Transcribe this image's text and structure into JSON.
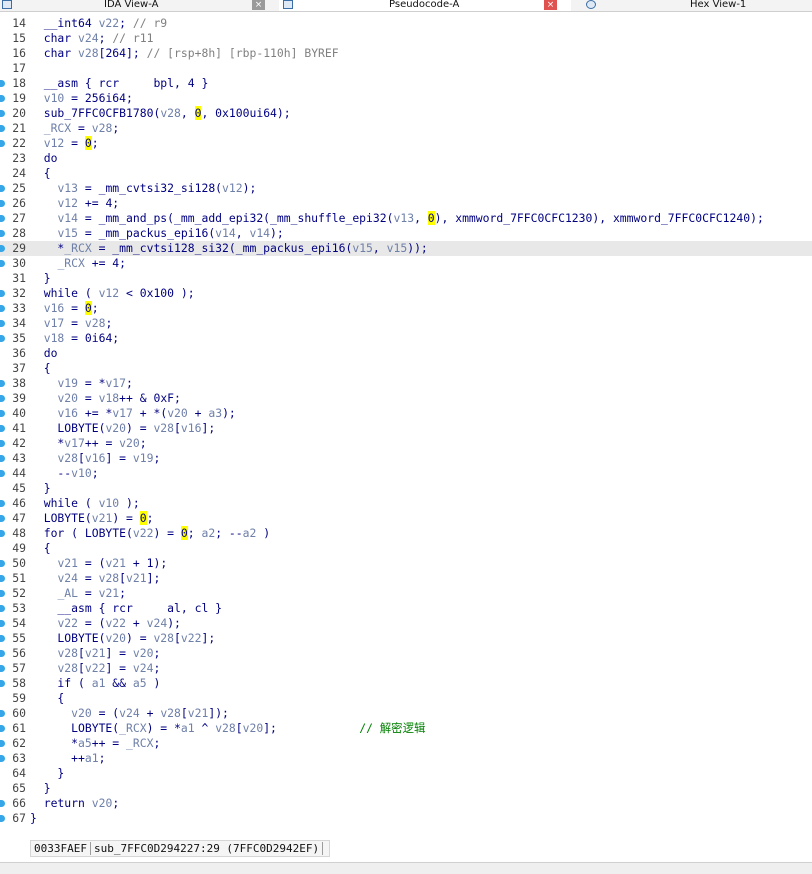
{
  "tabs": [
    {
      "label": "IDA View-A",
      "close": "×",
      "active": false
    },
    {
      "label": "Pseudocode-A",
      "close": "×",
      "active": true
    },
    {
      "label": "Hex View-1",
      "close": "",
      "active": false
    }
  ],
  "code_lines": [
    {
      "n": "14",
      "dot": false,
      "t": [
        [
          "p",
          "  __int64 "
        ],
        [
          "v",
          "v22"
        ],
        [
          "p",
          "; "
        ],
        [
          "c",
          "// r9"
        ]
      ]
    },
    {
      "n": "15",
      "dot": false,
      "t": [
        [
          "p",
          "  char "
        ],
        [
          "v",
          "v24"
        ],
        [
          "p",
          "; "
        ],
        [
          "c",
          "// r11"
        ]
      ]
    },
    {
      "n": "16",
      "dot": false,
      "t": [
        [
          "p",
          "  char "
        ],
        [
          "v",
          "v28"
        ],
        [
          "p",
          "[264]; "
        ],
        [
          "c",
          "// [rsp+8h] [rbp-110h] BYREF"
        ]
      ]
    },
    {
      "n": "17",
      "dot": false,
      "t": []
    },
    {
      "n": "18",
      "dot": true,
      "t": [
        [
          "p",
          "  __asm { rcr     bpl, 4 }"
        ]
      ]
    },
    {
      "n": "19",
      "dot": true,
      "t": [
        [
          "p",
          "  "
        ],
        [
          "v",
          "v10"
        ],
        [
          "p",
          " = 256i64;"
        ]
      ]
    },
    {
      "n": "20",
      "dot": true,
      "t": [
        [
          "p",
          "  sub_7FFC0CFB1780("
        ],
        [
          "v",
          "v28"
        ],
        [
          "p",
          ", "
        ],
        [
          "h",
          "0"
        ],
        [
          "p",
          ", 0x100ui64);"
        ]
      ]
    },
    {
      "n": "21",
      "dot": true,
      "t": [
        [
          "p",
          "  "
        ],
        [
          "v",
          "_RCX"
        ],
        [
          "p",
          " = "
        ],
        [
          "v",
          "v28"
        ],
        [
          "p",
          ";"
        ]
      ]
    },
    {
      "n": "22",
      "dot": true,
      "t": [
        [
          "p",
          "  "
        ],
        [
          "v",
          "v12"
        ],
        [
          "p",
          " = "
        ],
        [
          "h",
          "0"
        ],
        [
          "p",
          ";"
        ]
      ]
    },
    {
      "n": "23",
      "dot": false,
      "t": [
        [
          "p",
          "  do"
        ]
      ]
    },
    {
      "n": "24",
      "dot": false,
      "t": [
        [
          "p",
          "  {"
        ]
      ]
    },
    {
      "n": "25",
      "dot": true,
      "t": [
        [
          "p",
          "    "
        ],
        [
          "v",
          "v13"
        ],
        [
          "p",
          " = _mm_cvtsi32_si128("
        ],
        [
          "v",
          "v12"
        ],
        [
          "p",
          ");"
        ]
      ]
    },
    {
      "n": "26",
      "dot": true,
      "t": [
        [
          "p",
          "    "
        ],
        [
          "v",
          "v12"
        ],
        [
          "p",
          " += 4;"
        ]
      ]
    },
    {
      "n": "27",
      "dot": true,
      "t": [
        [
          "p",
          "    "
        ],
        [
          "v",
          "v14"
        ],
        [
          "p",
          " = _mm_and_ps(_mm_add_epi32(_mm_shuffle_epi32("
        ],
        [
          "v",
          "v13"
        ],
        [
          "p",
          ", "
        ],
        [
          "h",
          "0"
        ],
        [
          "p",
          "), xmmword_7FFC0CFC1230), xmmword_7FFC0CFC1240);"
        ]
      ]
    },
    {
      "n": "28",
      "dot": true,
      "t": [
        [
          "p",
          "    "
        ],
        [
          "v",
          "v15"
        ],
        [
          "p",
          " = _mm_packus_epi16("
        ],
        [
          "v",
          "v14"
        ],
        [
          "p",
          ", "
        ],
        [
          "v",
          "v14"
        ],
        [
          "p",
          ");"
        ]
      ]
    },
    {
      "n": "29",
      "dot": true,
      "cur": true,
      "t": [
        [
          "p",
          "    *"
        ],
        [
          "v",
          "_RCX"
        ],
        [
          "p",
          " = _mm_cvtsi128_si32(_mm_packus_epi16("
        ],
        [
          "v",
          "v15"
        ],
        [
          "p",
          ", "
        ],
        [
          "v",
          "v15"
        ],
        [
          "p",
          "));"
        ]
      ]
    },
    {
      "n": "30",
      "dot": true,
      "t": [
        [
          "p",
          "    "
        ],
        [
          "v",
          "_RCX"
        ],
        [
          "p",
          " += 4;"
        ]
      ]
    },
    {
      "n": "31",
      "dot": false,
      "t": [
        [
          "p",
          "  }"
        ]
      ]
    },
    {
      "n": "32",
      "dot": true,
      "t": [
        [
          "p",
          "  while ( "
        ],
        [
          "v",
          "v12"
        ],
        [
          "p",
          " < 0x100 );"
        ]
      ]
    },
    {
      "n": "33",
      "dot": true,
      "t": [
        [
          "p",
          "  "
        ],
        [
          "v",
          "v16"
        ],
        [
          "p",
          " = "
        ],
        [
          "h",
          "0"
        ],
        [
          "p",
          ";"
        ]
      ]
    },
    {
      "n": "34",
      "dot": true,
      "t": [
        [
          "p",
          "  "
        ],
        [
          "v",
          "v17"
        ],
        [
          "p",
          " = "
        ],
        [
          "v",
          "v28"
        ],
        [
          "p",
          ";"
        ]
      ]
    },
    {
      "n": "35",
      "dot": true,
      "t": [
        [
          "p",
          "  "
        ],
        [
          "v",
          "v18"
        ],
        [
          "p",
          " = 0i64;"
        ]
      ]
    },
    {
      "n": "36",
      "dot": false,
      "t": [
        [
          "p",
          "  do"
        ]
      ]
    },
    {
      "n": "37",
      "dot": false,
      "t": [
        [
          "p",
          "  {"
        ]
      ]
    },
    {
      "n": "38",
      "dot": true,
      "t": [
        [
          "p",
          "    "
        ],
        [
          "v",
          "v19"
        ],
        [
          "p",
          " = *"
        ],
        [
          "v",
          "v17"
        ],
        [
          "p",
          ";"
        ]
      ]
    },
    {
      "n": "39",
      "dot": true,
      "t": [
        [
          "p",
          "    "
        ],
        [
          "v",
          "v20"
        ],
        [
          "p",
          " = "
        ],
        [
          "v",
          "v18"
        ],
        [
          "p",
          "++ & 0xF;"
        ]
      ]
    },
    {
      "n": "40",
      "dot": true,
      "t": [
        [
          "p",
          "    "
        ],
        [
          "v",
          "v16"
        ],
        [
          "p",
          " += *"
        ],
        [
          "v",
          "v17"
        ],
        [
          "p",
          " + *("
        ],
        [
          "v",
          "v20"
        ],
        [
          "p",
          " + "
        ],
        [
          "v",
          "a3"
        ],
        [
          "p",
          ");"
        ]
      ]
    },
    {
      "n": "41",
      "dot": true,
      "t": [
        [
          "p",
          "    LOBYTE("
        ],
        [
          "v",
          "v20"
        ],
        [
          "p",
          ") = "
        ],
        [
          "v",
          "v28"
        ],
        [
          "p",
          "["
        ],
        [
          "v",
          "v16"
        ],
        [
          "p",
          "];"
        ]
      ]
    },
    {
      "n": "42",
      "dot": true,
      "t": [
        [
          "p",
          "    *"
        ],
        [
          "v",
          "v17"
        ],
        [
          "p",
          "++ = "
        ],
        [
          "v",
          "v20"
        ],
        [
          "p",
          ";"
        ]
      ]
    },
    {
      "n": "43",
      "dot": true,
      "t": [
        [
          "p",
          "    "
        ],
        [
          "v",
          "v28"
        ],
        [
          "p",
          "["
        ],
        [
          "v",
          "v16"
        ],
        [
          "p",
          "] = "
        ],
        [
          "v",
          "v19"
        ],
        [
          "p",
          ";"
        ]
      ]
    },
    {
      "n": "44",
      "dot": true,
      "t": [
        [
          "p",
          "    --"
        ],
        [
          "v",
          "v10"
        ],
        [
          "p",
          ";"
        ]
      ]
    },
    {
      "n": "45",
      "dot": false,
      "t": [
        [
          "p",
          "  }"
        ]
      ]
    },
    {
      "n": "46",
      "dot": true,
      "t": [
        [
          "p",
          "  while ( "
        ],
        [
          "v",
          "v10"
        ],
        [
          "p",
          " );"
        ]
      ]
    },
    {
      "n": "47",
      "dot": true,
      "t": [
        [
          "p",
          "  LOBYTE("
        ],
        [
          "v",
          "v21"
        ],
        [
          "p",
          ") = "
        ],
        [
          "h",
          "0"
        ],
        [
          "p",
          ";"
        ]
      ]
    },
    {
      "n": "48",
      "dot": true,
      "t": [
        [
          "p",
          "  for ( LOBYTE("
        ],
        [
          "v",
          "v22"
        ],
        [
          "p",
          ") = "
        ],
        [
          "h",
          "0"
        ],
        [
          "p",
          "; "
        ],
        [
          "v",
          "a2"
        ],
        [
          "p",
          "; --"
        ],
        [
          "v",
          "a2"
        ],
        [
          "p",
          " )"
        ]
      ]
    },
    {
      "n": "49",
      "dot": false,
      "t": [
        [
          "p",
          "  {"
        ]
      ]
    },
    {
      "n": "50",
      "dot": true,
      "t": [
        [
          "p",
          "    "
        ],
        [
          "v",
          "v21"
        ],
        [
          "p",
          " = ("
        ],
        [
          "v",
          "v21"
        ],
        [
          "p",
          " + 1);"
        ]
      ]
    },
    {
      "n": "51",
      "dot": true,
      "t": [
        [
          "p",
          "    "
        ],
        [
          "v",
          "v24"
        ],
        [
          "p",
          " = "
        ],
        [
          "v",
          "v28"
        ],
        [
          "p",
          "["
        ],
        [
          "v",
          "v21"
        ],
        [
          "p",
          "];"
        ]
      ]
    },
    {
      "n": "52",
      "dot": true,
      "t": [
        [
          "p",
          "    "
        ],
        [
          "v",
          "_AL"
        ],
        [
          "p",
          " = "
        ],
        [
          "v",
          "v21"
        ],
        [
          "p",
          ";"
        ]
      ]
    },
    {
      "n": "53",
      "dot": true,
      "t": [
        [
          "p",
          "    __asm { rcr     al, cl }"
        ]
      ]
    },
    {
      "n": "54",
      "dot": true,
      "t": [
        [
          "p",
          "    "
        ],
        [
          "v",
          "v22"
        ],
        [
          "p",
          " = ("
        ],
        [
          "v",
          "v22"
        ],
        [
          "p",
          " + "
        ],
        [
          "v",
          "v24"
        ],
        [
          "p",
          ");"
        ]
      ]
    },
    {
      "n": "55",
      "dot": true,
      "t": [
        [
          "p",
          "    LOBYTE("
        ],
        [
          "v",
          "v20"
        ],
        [
          "p",
          ") = "
        ],
        [
          "v",
          "v28"
        ],
        [
          "p",
          "["
        ],
        [
          "v",
          "v22"
        ],
        [
          "p",
          "];"
        ]
      ]
    },
    {
      "n": "56",
      "dot": true,
      "t": [
        [
          "p",
          "    "
        ],
        [
          "v",
          "v28"
        ],
        [
          "p",
          "["
        ],
        [
          "v",
          "v21"
        ],
        [
          "p",
          "] = "
        ],
        [
          "v",
          "v20"
        ],
        [
          "p",
          ";"
        ]
      ]
    },
    {
      "n": "57",
      "dot": true,
      "t": [
        [
          "p",
          "    "
        ],
        [
          "v",
          "v28"
        ],
        [
          "p",
          "["
        ],
        [
          "v",
          "v22"
        ],
        [
          "p",
          "] = "
        ],
        [
          "v",
          "v24"
        ],
        [
          "p",
          ";"
        ]
      ]
    },
    {
      "n": "58",
      "dot": true,
      "t": [
        [
          "p",
          "    if ( "
        ],
        [
          "v",
          "a1"
        ],
        [
          "p",
          " && "
        ],
        [
          "v",
          "a5"
        ],
        [
          "p",
          " )"
        ]
      ]
    },
    {
      "n": "59",
      "dot": false,
      "t": [
        [
          "p",
          "    {"
        ]
      ]
    },
    {
      "n": "60",
      "dot": true,
      "t": [
        [
          "p",
          "      "
        ],
        [
          "v",
          "v20"
        ],
        [
          "p",
          " = ("
        ],
        [
          "v",
          "v24"
        ],
        [
          "p",
          " + "
        ],
        [
          "v",
          "v28"
        ],
        [
          "p",
          "["
        ],
        [
          "v",
          "v21"
        ],
        [
          "p",
          "]);"
        ]
      ]
    },
    {
      "n": "61",
      "dot": true,
      "t": [
        [
          "p",
          "      LOBYTE("
        ],
        [
          "v",
          "_RCX"
        ],
        [
          "p",
          ") = *"
        ],
        [
          "v",
          "a1"
        ],
        [
          "p",
          " ^ "
        ],
        [
          "v",
          "v28"
        ],
        [
          "p",
          "["
        ],
        [
          "v",
          "v20"
        ],
        [
          "p",
          "];            "
        ],
        [
          "g",
          "// 解密逻辑"
        ]
      ]
    },
    {
      "n": "62",
      "dot": true,
      "t": [
        [
          "p",
          "      *"
        ],
        [
          "v",
          "a5"
        ],
        [
          "p",
          "++ = "
        ],
        [
          "v",
          "_RCX"
        ],
        [
          "p",
          ";"
        ]
      ]
    },
    {
      "n": "63",
      "dot": true,
      "t": [
        [
          "p",
          "      ++"
        ],
        [
          "v",
          "a1"
        ],
        [
          "p",
          ";"
        ]
      ]
    },
    {
      "n": "64",
      "dot": false,
      "t": [
        [
          "p",
          "    }"
        ]
      ]
    },
    {
      "n": "65",
      "dot": false,
      "t": [
        [
          "p",
          "  }"
        ]
      ]
    },
    {
      "n": "66",
      "dot": true,
      "t": [
        [
          "p",
          "  return "
        ],
        [
          "v",
          "v20"
        ],
        [
          "p",
          ";"
        ]
      ]
    },
    {
      "n": "67",
      "dot": true,
      "t": [
        [
          "p",
          "}"
        ]
      ]
    }
  ],
  "status": {
    "offset": "0033FAEF",
    "location": "sub_7FFC0D294227:29 (7FFC0D2942EF)"
  },
  "colors": {
    "keyword_text": "#000080",
    "variable": "#6e7fa8",
    "comment": "#808080",
    "comment_green": "#008000",
    "highlight": "#ffff00",
    "breakpoint_dot": "#35a6e8",
    "close_button": "#e0524f"
  }
}
